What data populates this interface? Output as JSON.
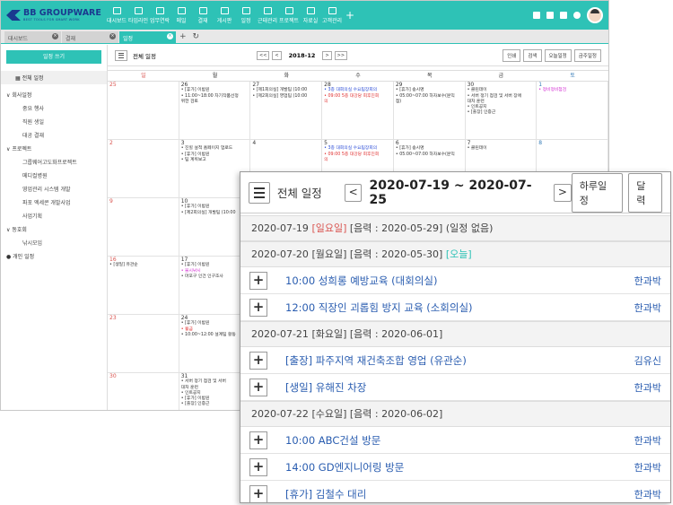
{
  "app": {
    "logo": "BB GROUPWARE",
    "logo_sub": "BEST TOOLS FOR SMART WORK",
    "menu": [
      "대시보드",
      "타임라인",
      "업무연락",
      "메일",
      "결재",
      "게시판",
      "일정",
      "근태관리",
      "프로젝트",
      "자료실",
      "고객관리"
    ],
    "menu_plus": "+",
    "tabs": [
      {
        "label": "대시보드",
        "active": false
      },
      {
        "label": "결재",
        "active": false
      },
      {
        "label": "일정",
        "active": true
      }
    ],
    "tab_add": "+",
    "tab_refresh": "↻"
  },
  "sidebar": {
    "write_button": "일정 쓰기",
    "all_schedule": "전체 일정",
    "groups": [
      {
        "label": "회사일정",
        "items": [
          "중요 행사",
          "직원 생일",
          "대공 결재"
        ]
      },
      {
        "label": "프로젝트",
        "items": [
          "그룹웨어고도화프로젝트",
          "메디컬병원",
          "영업관리 시스템 개발",
          "파포 엑세콘 개발사업",
          "사업기획"
        ]
      },
      {
        "label": "동호회",
        "items": [
          "낚시모임"
        ]
      }
    ],
    "personal": "개인 일정"
  },
  "calendar": {
    "title": "전체 일정",
    "month": "2018-12",
    "nav_first": "<<",
    "nav_prev": "<",
    "nav_next": ">",
    "nav_last": ">>",
    "actions": [
      "인쇄",
      "검색",
      "오늘일정",
      "금주일정"
    ],
    "weekdays": [
      "일",
      "월",
      "화",
      "수",
      "목",
      "금",
      "토"
    ],
    "weeks": [
      [
        {
          "day": "25",
          "events": []
        },
        {
          "day": "26",
          "events": [
            {
              "t": "• [휴가] 이밤원",
              "c": ""
            },
            {
              "t": "• 11:00~18:00 차기작품선정",
              "c": ""
            },
            {
              "t": "위한 검토",
              "c": ""
            }
          ]
        },
        {
          "day": "27",
          "events": [
            {
              "t": "• [제1회의실] 개발팀 (10:00",
              "c": ""
            },
            {
              "t": "• [제2회의실] 영업팀 (10:00",
              "c": ""
            }
          ]
        },
        {
          "day": "28",
          "events": [
            {
              "t": "• 3층 대회의실 수요팀장회의",
              "c": "blue"
            },
            {
              "t": "• 09:00 5층 대강당 회후진회",
              "c": "red"
            },
            {
              "t": "의",
              "c": "red"
            }
          ]
        },
        {
          "day": "29",
          "events": [
            {
              "t": "• [휴가] 송시명",
              "c": ""
            },
            {
              "t": "• 05:00~07:00 하자보수(문익",
              "c": ""
            },
            {
              "t": "점)",
              "c": ""
            }
          ]
        },
        {
          "day": "30",
          "events": [
            {
              "t": "• 클린데이",
              "c": ""
            },
            {
              "t": "• 서버 정기 점검 및 서버 장애",
              "c": ""
            },
            {
              "t": "대처 훈련",
              "c": ""
            },
            {
              "t": "• 인트공지",
              "c": ""
            },
            {
              "t": "• [출장] 인증근",
              "c": ""
            }
          ]
        },
        {
          "day": "1",
          "events": [
            {
              "t": "• 정비정비점검",
              "c": "pink"
            }
          ]
        }
      ],
      [
        {
          "day": "2",
          "events": []
        },
        {
          "day": "3",
          "events": [
            {
              "t": "• 진힐 설적 홈페이지 업로드",
              "c": ""
            },
            {
              "t": "• [휴가] 이밤원",
              "c": ""
            },
            {
              "t": "• 팀 계획보고",
              "c": ""
            }
          ]
        },
        {
          "day": "4",
          "events": []
        },
        {
          "day": "5",
          "events": [
            {
              "t": "• 3층 대회의실 수요팀장회의",
              "c": "blue"
            },
            {
              "t": "• 09:00 5층 대강당 회후진회",
              "c": "red"
            },
            {
              "t": "의",
              "c": "red"
            }
          ]
        },
        {
          "day": "6",
          "events": [
            {
              "t": "• [휴가] 송시명",
              "c": ""
            },
            {
              "t": "• 05:00~07:00 하자보수(문익",
              "c": ""
            }
          ]
        },
        {
          "day": "7",
          "events": [
            {
              "t": "• 클린데이",
              "c": ""
            }
          ]
        },
        {
          "day": "8",
          "events": []
        }
      ],
      [
        {
          "day": "9",
          "events": []
        },
        {
          "day": "10",
          "events": [
            {
              "t": "• [휴가] 이밤원",
              "c": ""
            },
            {
              "t": "• [제2회의실] 개발팀 (10:00",
              "c": ""
            }
          ]
        },
        {
          "day": "",
          "events": []
        },
        {
          "day": "",
          "events": []
        },
        {
          "day": "",
          "events": []
        },
        {
          "day": "",
          "events": []
        },
        {
          "day": "",
          "events": []
        }
      ],
      [
        {
          "day": "16",
          "events": [
            {
              "t": "• [생일] 유관순",
              "c": ""
            }
          ]
        },
        {
          "day": "17",
          "events": [
            {
              "t": "• [휴가] 이밤원",
              "c": ""
            },
            {
              "t": "• 불시낚시",
              "c": "pink"
            },
            {
              "t": "• 마포구 인건 인구조사",
              "c": ""
            }
          ]
        },
        {
          "day": "",
          "events": []
        },
        {
          "day": "",
          "events": []
        },
        {
          "day": "",
          "events": []
        },
        {
          "day": "",
          "events": []
        },
        {
          "day": "",
          "events": []
        }
      ],
      [
        {
          "day": "23",
          "events": []
        },
        {
          "day": "24",
          "events": [
            {
              "t": "• [휴가] 이밤원",
              "c": ""
            },
            {
              "t": "• 휠금",
              "c": "red"
            },
            {
              "t": "• 10:00~12:00 설계팀 활동",
              "c": ""
            }
          ]
        },
        {
          "day": "",
          "events": []
        },
        {
          "day": "",
          "events": []
        },
        {
          "day": "",
          "events": []
        },
        {
          "day": "",
          "events": []
        },
        {
          "day": "",
          "events": []
        }
      ],
      [
        {
          "day": "30",
          "events": []
        },
        {
          "day": "31",
          "events": [
            {
              "t": "• 서버 정기 점검 및 서버",
              "c": ""
            },
            {
              "t": "대처 훈련",
              "c": ""
            },
            {
              "t": "• 인트공지",
              "c": ""
            },
            {
              "t": "• [휴가] 이밤원",
              "c": ""
            },
            {
              "t": "• [출장] 인증근",
              "c": ""
            }
          ]
        },
        {
          "day": "",
          "events": []
        },
        {
          "day": "",
          "events": []
        },
        {
          "day": "",
          "events": []
        },
        {
          "day": "",
          "events": []
        },
        {
          "day": "",
          "events": []
        }
      ]
    ]
  },
  "overlay": {
    "title": "전체 일정",
    "prev": "<",
    "next": ">",
    "range": "2020-07-19 ~ 2020-07-25",
    "btn_daily": "하루일정",
    "btn_calendar": "달력",
    "days": [
      {
        "date": "2020-07-19",
        "dow": "[일요일]",
        "holiday": true,
        "lunar": "[음력 : 2020-05-29]",
        "note": "(일정 없음)",
        "today": false,
        "events": []
      },
      {
        "date": "2020-07-20",
        "dow": "[월요일]",
        "holiday": false,
        "lunar": "[음력 : 2020-05-30]",
        "note": "[오늘]",
        "today": true,
        "events": [
          {
            "text": "10:00 성희롱 예방교육 (대회의실)",
            "owner": "한과박"
          },
          {
            "text": "12:00 직장인 괴롭힘 방지 교육 (소회의실)",
            "owner": "한과박"
          }
        ]
      },
      {
        "date": "2020-07-21",
        "dow": "[화요일]",
        "holiday": false,
        "lunar": "[음력 : 2020-06-01]",
        "note": "",
        "today": false,
        "events": [
          {
            "text": "[출장] 파주지역 재건축조합 영업 (유관순)",
            "owner": "김유신"
          },
          {
            "text": "[생일] 유해진 차장",
            "owner": "한과박"
          }
        ]
      },
      {
        "date": "2020-07-22",
        "dow": "[수요일]",
        "holiday": false,
        "lunar": "[음력 : 2020-06-02]",
        "note": "",
        "today": false,
        "events": [
          {
            "text": "10:00 ABC건설 방문",
            "owner": "한과박"
          },
          {
            "text": "14:00 GD엔지니어링 방문",
            "owner": "한과박"
          },
          {
            "text": "[휴가] 김철수 대리",
            "owner": "한과박"
          }
        ]
      }
    ]
  },
  "colors": {
    "accent": "#2ec2b6",
    "sunday": "#d9534f",
    "saturday": "#337ab7",
    "link": "#2a5db0"
  }
}
